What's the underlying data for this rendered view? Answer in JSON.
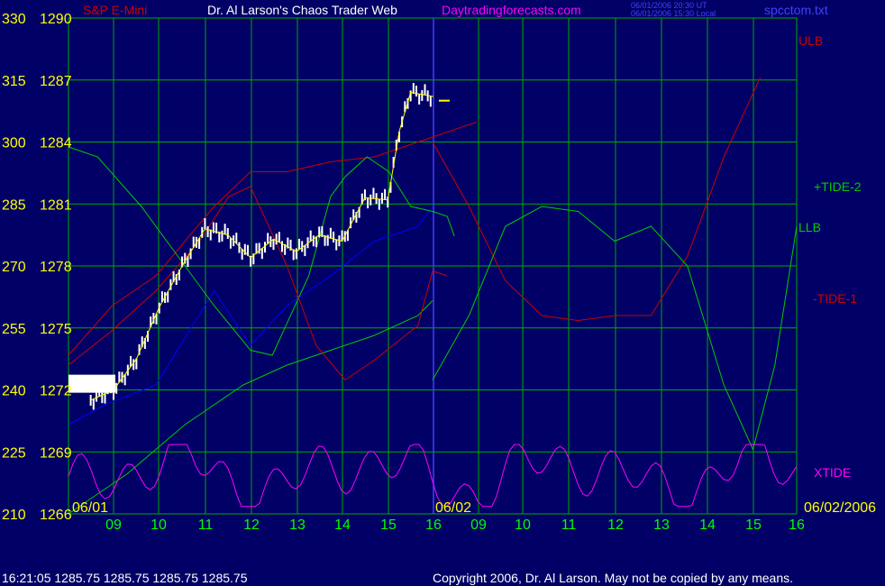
{
  "header": {
    "instrument": "S&P E-Mini",
    "site_title": "Dr. Al Larson's Chaos Trader Web",
    "site_url": "Daytradingforecasts.com",
    "timestamp_ut": "06/01/2006 20:30 UT",
    "timestamp_local": "06/01/2006 15:30 Local",
    "chart_file": "spcctom.txt"
  },
  "footer": {
    "quote": "16:21:05  1285.75 1285.75 1285.75 1285.75",
    "copyright": "Copyright 2006, Dr. Al Larson. May not be copied by any means."
  },
  "colors": {
    "background": "#000066",
    "grid": "#00aa00",
    "price_bars": "#ffffff",
    "moving_avg_yellow": "#ffff00",
    "moving_avg_blue": "#0000ff",
    "ulb": "#cc0000",
    "llb": "#00cc00",
    "plus_tide_2": "#00cc00",
    "minus_tide_1": "#cc0000",
    "xtide": "#ff00ff",
    "axis_tick_left": "#ffff00",
    "axis_tick_bottom": "#00ff00",
    "divider": "#4040ff"
  },
  "chart_data": {
    "type": "line",
    "left_axis_cycle": [
      "330",
      "315",
      "300",
      "285",
      "270",
      "255",
      "240",
      "225",
      "210"
    ],
    "left_axis_price": [
      "1290",
      "1287",
      "1284",
      "1281",
      "1278",
      "1275",
      "1272",
      "1269",
      "1266"
    ],
    "ylim_price": [
      1266,
      1290
    ],
    "x_ticks": [
      "09",
      "10",
      "11",
      "12",
      "13",
      "14",
      "15",
      "16",
      "09",
      "10",
      "11",
      "12",
      "13",
      "14",
      "15",
      "16"
    ],
    "date_labels": {
      "start": "06/01",
      "divider": "06/02",
      "end": "06/02/2006"
    },
    "series_labels": {
      "ulb": "ULB",
      "plus_tide": "+TIDE-2",
      "llb": "LLB",
      "minus_tide": "-TIDE-1",
      "xtide": "XTIDE"
    },
    "price_close_by_hour": [
      {
        "x": "08:30",
        "y": 1271.5
      },
      {
        "x": "09:00",
        "y": 1272.0
      },
      {
        "x": "09:30",
        "y": 1273.5
      },
      {
        "x": "10:00",
        "y": 1276.0
      },
      {
        "x": "10:30",
        "y": 1278.0
      },
      {
        "x": "11:00",
        "y": 1279.8
      },
      {
        "x": "11:30",
        "y": 1279.5
      },
      {
        "x": "12:00",
        "y": 1278.4
      },
      {
        "x": "12:30",
        "y": 1279.3
      },
      {
        "x": "13:00",
        "y": 1278.7
      },
      {
        "x": "13:30",
        "y": 1279.5
      },
      {
        "x": "14:00",
        "y": 1279.2
      },
      {
        "x": "14:30",
        "y": 1281.3
      },
      {
        "x": "15:00",
        "y": 1281.2
      },
      {
        "x": "15:15",
        "y": 1284.5
      },
      {
        "x": "15:30",
        "y": 1286.4
      },
      {
        "x": "16:00",
        "y": 1286.2
      }
    ],
    "forecast_next_open": 1286.0,
    "xtide_peak_hours_day2": [
      "09:00",
      "10:00",
      "12:00",
      "13:45",
      "15:00"
    ]
  }
}
